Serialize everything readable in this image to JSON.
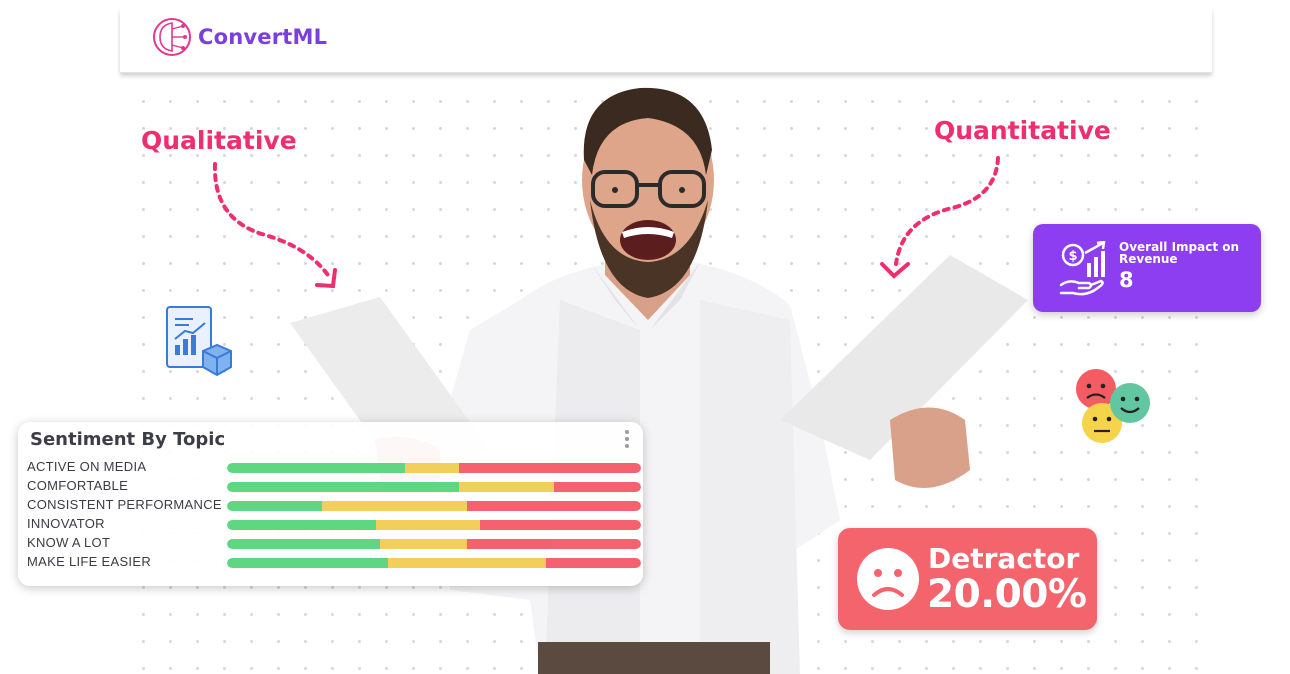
{
  "header": {
    "brand_name": "ConvertML",
    "logo_icon": "circuit-brain-icon"
  },
  "annotations": {
    "left_label": "Qualitative",
    "right_label": "Quantitative"
  },
  "sentiment_card": {
    "title": "Sentiment By Topic",
    "menu_icon": "kebab-menu-icon",
    "rows": [
      {
        "label": "ACTIVE ON MEDIA",
        "positive": 0.43,
        "neutral": 0.13,
        "negative": 0.44
      },
      {
        "label": "COMFORTABLE",
        "positive": 0.56,
        "neutral": 0.23,
        "negative": 0.21
      },
      {
        "label": "CONSISTENT PERFORMANCE",
        "positive": 0.23,
        "neutral": 0.35,
        "negative": 0.42
      },
      {
        "label": "INNOVATOR",
        "positive": 0.36,
        "neutral": 0.25,
        "negative": 0.39
      },
      {
        "label": "KNOW A LOT",
        "positive": 0.37,
        "neutral": 0.21,
        "negative": 0.42
      },
      {
        "label": "MAKE LIFE EASIER",
        "positive": 0.39,
        "neutral": 0.38,
        "negative": 0.23
      }
    ],
    "colors": {
      "positive": "#5fd682",
      "neutral": "#f2cf5a",
      "negative": "#f4616f"
    }
  },
  "impact_card": {
    "title": "Overall Impact on Revenue",
    "value": "8",
    "icon": "revenue-growth-icon",
    "color": "#8c3ef0"
  },
  "detractor_card": {
    "label": "Detractor",
    "value": "20.00%",
    "icon": "sad-face-icon",
    "color": "#f4646d"
  },
  "decor": {
    "report_icon": "report-chart-icon",
    "emoji_icons": [
      "sad-emoji-icon",
      "happy-emoji-icon",
      "neutral-emoji-icon"
    ],
    "accent_color": "#ee2e6f"
  }
}
